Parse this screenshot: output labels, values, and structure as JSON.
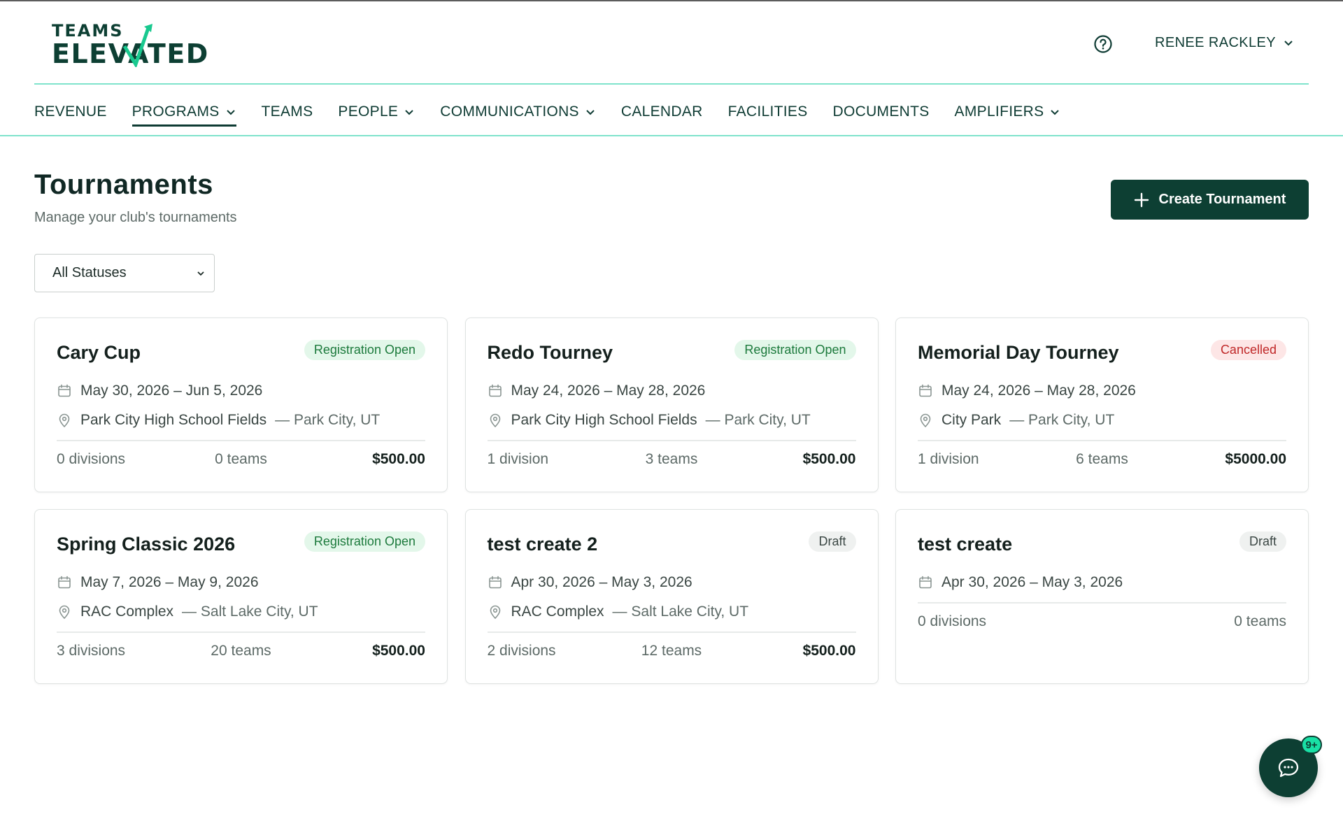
{
  "app": {
    "logo_line1": "TEAMS",
    "logo_line2": "ELEVATED",
    "user_name": "RENEE RACKLEY"
  },
  "nav": [
    {
      "label": "REVENUE",
      "dropdown": false,
      "active": false
    },
    {
      "label": "PROGRAMS",
      "dropdown": true,
      "active": true
    },
    {
      "label": "TEAMS",
      "dropdown": false,
      "active": false
    },
    {
      "label": "PEOPLE",
      "dropdown": true,
      "active": false
    },
    {
      "label": "COMMUNICATIONS",
      "dropdown": true,
      "active": false
    },
    {
      "label": "CALENDAR",
      "dropdown": false,
      "active": false
    },
    {
      "label": "FACILITIES",
      "dropdown": false,
      "active": false
    },
    {
      "label": "DOCUMENTS",
      "dropdown": false,
      "active": false
    },
    {
      "label": "AMPLIFIERS",
      "dropdown": true,
      "active": false
    }
  ],
  "page": {
    "title": "Tournaments",
    "subtitle": "Manage your club's tournaments",
    "create_label": "Create Tournament",
    "status_filter": "All Statuses"
  },
  "tournaments": [
    {
      "name": "Cary Cup",
      "status": "Registration Open",
      "status_kind": "open",
      "dates": "May 30, 2026 – Jun 5, 2026",
      "venue": "Park City High School Fields",
      "city": "— Park City, UT",
      "divisions": "0 divisions",
      "teams": "0 teams",
      "price": "$500.00"
    },
    {
      "name": "Redo Tourney",
      "status": "Registration Open",
      "status_kind": "open",
      "dates": "May 24, 2026 – May 28, 2026",
      "venue": "Park City High School Fields",
      "city": "— Park City, UT",
      "divisions": "1 division",
      "teams": "3 teams",
      "price": "$500.00"
    },
    {
      "name": "Memorial Day Tourney",
      "status": "Cancelled",
      "status_kind": "cancelled",
      "dates": "May 24, 2026 – May 28, 2026",
      "venue": "City Park",
      "city": "— Park City, UT",
      "divisions": "1 division",
      "teams": "6 teams",
      "price": "$5000.00"
    },
    {
      "name": "Spring Classic 2026",
      "status": "Registration Open",
      "status_kind": "open",
      "dates": "May 7, 2026 – May 9, 2026",
      "venue": "RAC Complex",
      "city": "— Salt Lake City, UT",
      "divisions": "3 divisions",
      "teams": "20 teams",
      "price": "$500.00"
    },
    {
      "name": "test create 2",
      "status": "Draft",
      "status_kind": "draft",
      "dates": "Apr 30, 2026 – May 3, 2026",
      "venue": "RAC Complex",
      "city": "— Salt Lake City, UT",
      "divisions": "2 divisions",
      "teams": "12 teams",
      "price": "$500.00"
    },
    {
      "name": "test create",
      "status": "Draft",
      "status_kind": "draft",
      "dates": "Apr 30, 2026 – May 3, 2026",
      "venue": "",
      "city": "",
      "divisions": "0 divisions",
      "teams": "0 teams",
      "price": ""
    }
  ],
  "chat": {
    "badge": "9+"
  },
  "colors": {
    "brand": "#0d3f33",
    "accent": "#19e0a5",
    "rule": "#7fe3cc"
  },
  "icons": {
    "help": "help-circle-icon",
    "calendar": "calendar-icon",
    "location": "map-pin-icon",
    "chat": "chat-bubble-icon",
    "plus": "plus-icon",
    "chevron": "chevron-down-icon"
  }
}
